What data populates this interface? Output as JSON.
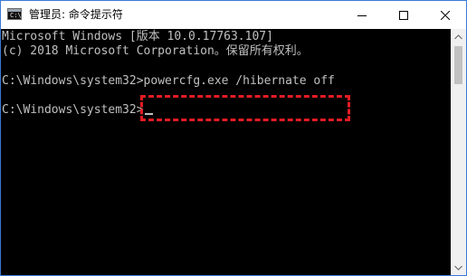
{
  "window": {
    "title": "管理员: 命令提示符",
    "icon_label": "C:\\"
  },
  "controls": {
    "minimize": "minimize-icon",
    "maximize": "maximize-icon",
    "close": "close-icon"
  },
  "console": {
    "lines": [
      "Microsoft Windows [版本 10.0.17763.107]",
      "(c) 2018 Microsoft Corporation。保留所有权利。",
      "",
      "C:\\Windows\\system32>",
      "",
      "C:\\Windows\\system32>"
    ],
    "command": "powercfg.exe /hibernate off"
  },
  "colors": {
    "console_bg": "#000000",
    "console_text": "#c0c0c0",
    "highlight_border": "#e31b23"
  }
}
